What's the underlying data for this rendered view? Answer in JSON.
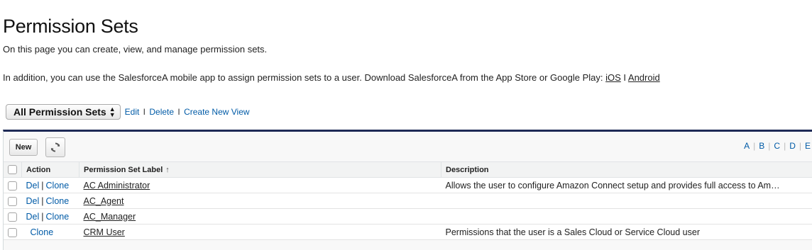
{
  "page": {
    "title": "Permission Sets",
    "intro": "On this page you can create, view, and manage permission sets.",
    "intro2_prefix": "In addition, you can use the SalesforceA mobile app to assign permission sets to a user. Download SalesforceA from the App Store or Google Play: ",
    "link_ios": "iOS",
    "link_sep": " I ",
    "link_android": "Android"
  },
  "view": {
    "selected": "All Permission Sets",
    "edit": "Edit",
    "delete": "Delete",
    "create_new": "Create New View",
    "sep": "I"
  },
  "toolbar": {
    "new_label": "New",
    "alpha": [
      "A",
      "B",
      "C",
      "D",
      "E"
    ]
  },
  "table": {
    "headers": {
      "action": "Action",
      "label": "Permission Set Label",
      "sort_indicator": "↑",
      "description": "Description"
    },
    "rows": [
      {
        "del": "Del",
        "clone": "Clone",
        "sep": "|",
        "label": "AC Administrator",
        "description": "Allows the user to configure Amazon Connect setup and provides full access to Am…"
      },
      {
        "del": "Del",
        "clone": "Clone",
        "sep": "|",
        "label": "AC_Agent",
        "description": ""
      },
      {
        "del": "Del",
        "clone": "Clone",
        "sep": "|",
        "label": "AC_Manager",
        "description": ""
      },
      {
        "del": "",
        "clone": "Clone",
        "sep": "",
        "label": "CRM User",
        "description": "Permissions that the user is a Sales Cloud or Service Cloud user"
      }
    ]
  },
  "colors": {
    "link": "#015ba7",
    "header_rule": "#1e2a56"
  }
}
